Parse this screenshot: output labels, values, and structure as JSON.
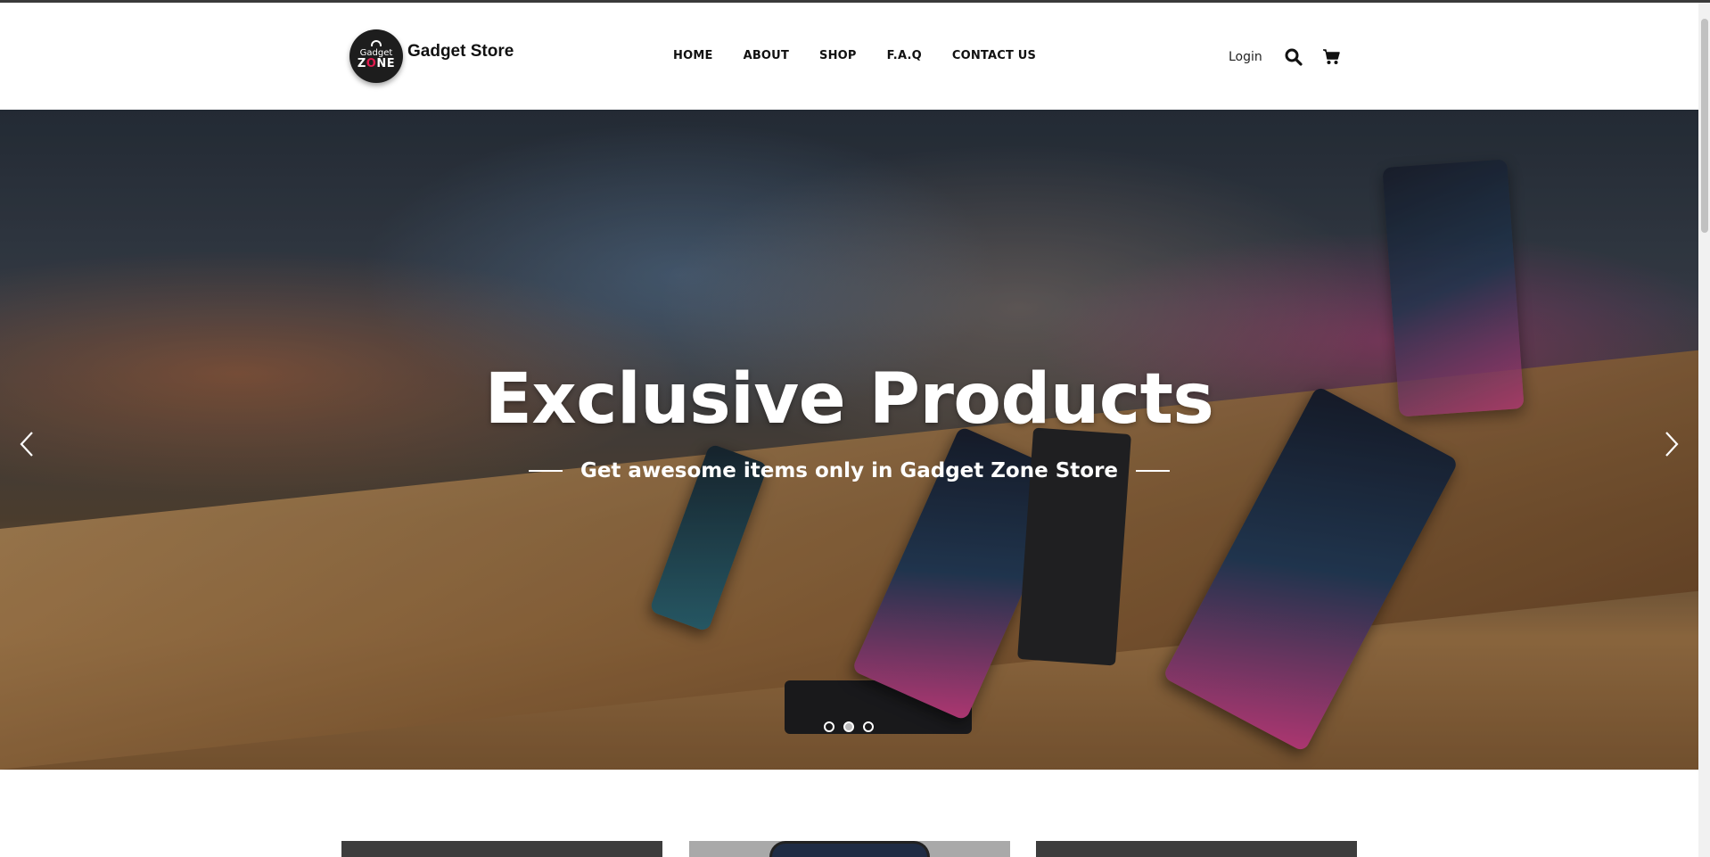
{
  "header": {
    "logo": {
      "line1": "Gadget",
      "line2": "ZONE",
      "alt_icon": "robot-logo-icon"
    },
    "brand_name": "Gadget Store",
    "nav": [
      {
        "label": "HOME"
      },
      {
        "label": "ABOUT"
      },
      {
        "label": "SHOP"
      },
      {
        "label": "F.A.Q"
      },
      {
        "label": "CONTACT US"
      }
    ],
    "login_label": "Login",
    "icons": [
      "search-icon",
      "cart-icon"
    ]
  },
  "hero": {
    "title": "Exclusive Products",
    "subtitle": "Get awesome items only in Gadget Zone Store",
    "prev_icon": "chevron-left-icon",
    "next_icon": "chevron-right-icon",
    "slides": 3,
    "active_slide": 2
  },
  "colors": {
    "text_dark": "#111111",
    "hero_text": "#ffffff",
    "logo_bg": "#1d1d1d",
    "logo_accent": "#e0194d"
  }
}
